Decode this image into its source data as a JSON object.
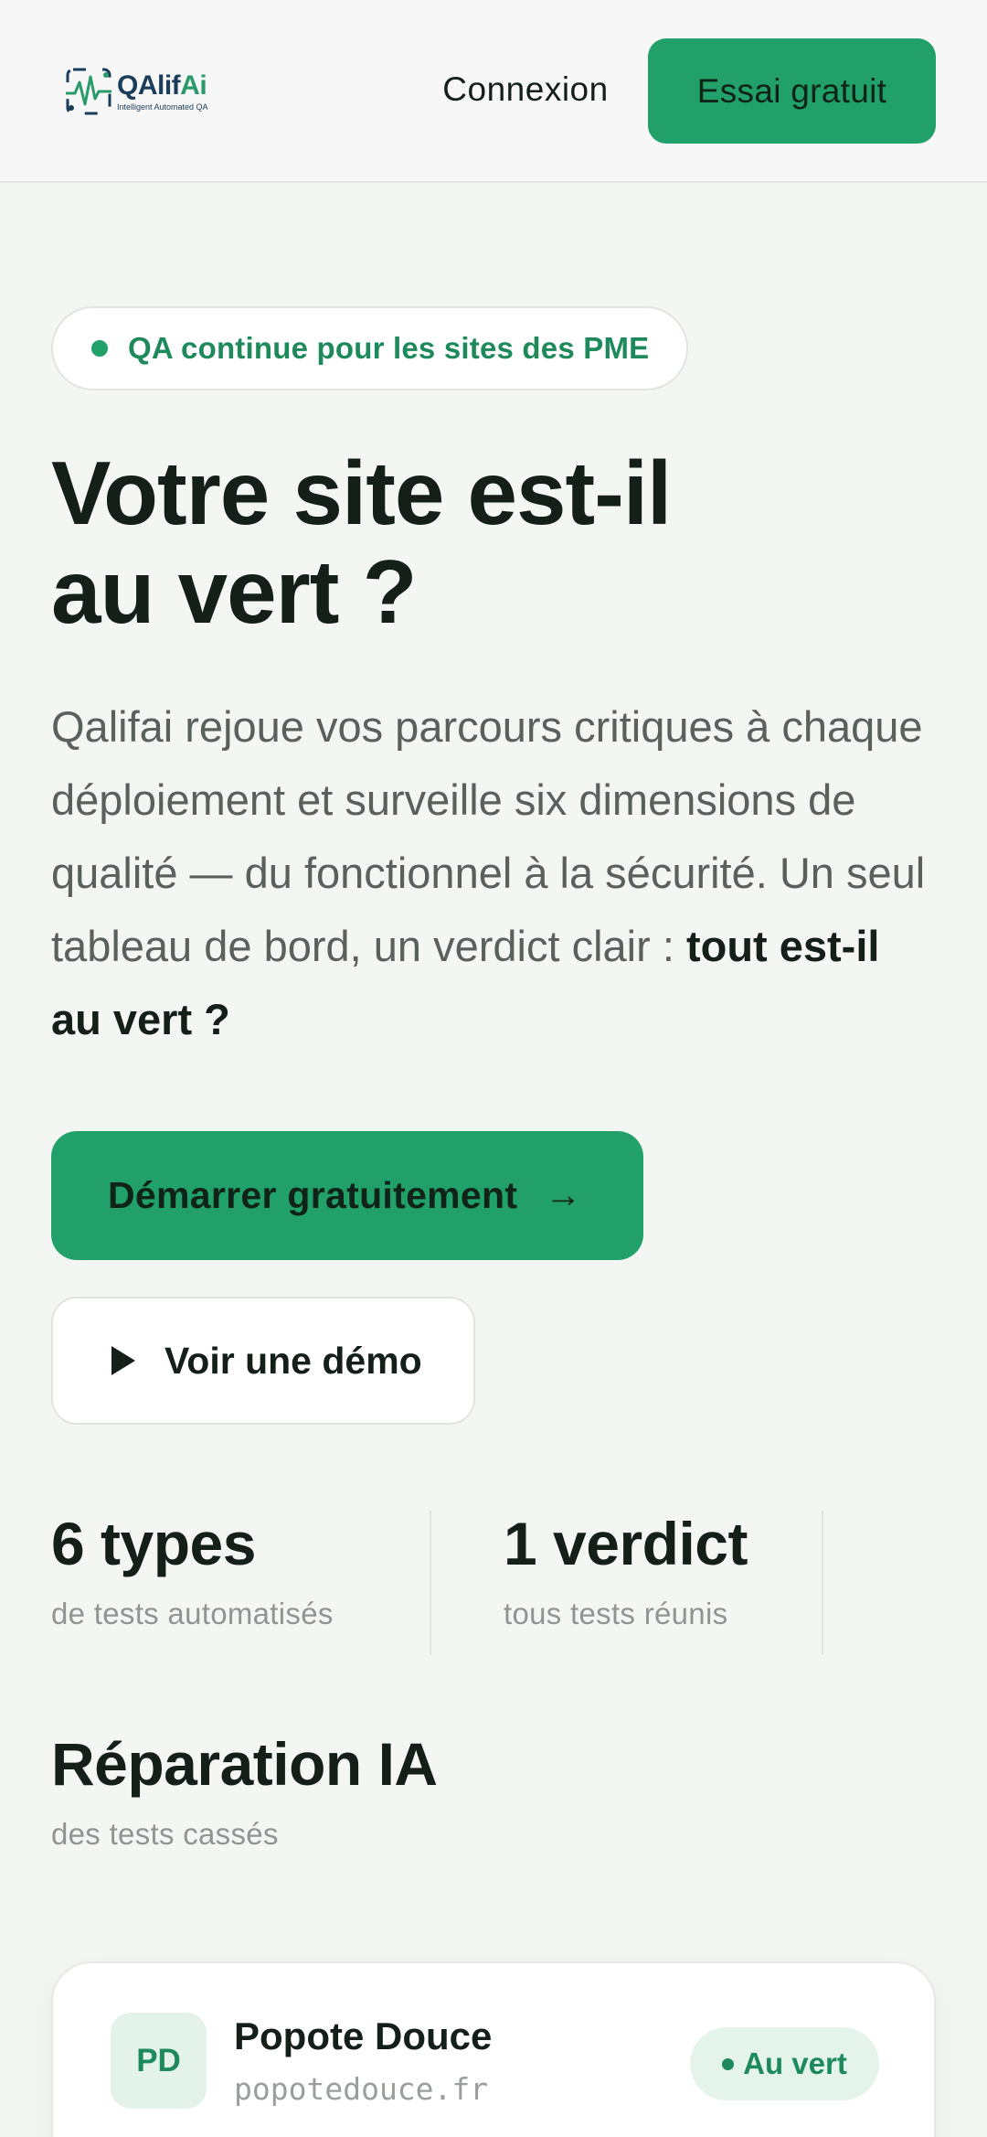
{
  "header": {
    "logo": {
      "name_main": "QAlif",
      "name_accent": "Ai",
      "tagline": "Intelligent Automated QA"
    },
    "login_label": "Connexion",
    "trial_label": "Essai gratuit"
  },
  "hero": {
    "badge": "QA continue pour les sites des PME",
    "title_line1": "Votre site est-il",
    "title_line2": "au vert ?",
    "description": "Qalifai rejoue vos parcours critiques à chaque déploiement et surveille six dimensions de qualité — du fonctionnel à la sécurité. Un seul tableau de bord, un verdict clair : ",
    "description_strong": "tout est-il au vert ?",
    "cta_primary": "Démarrer gratuitement",
    "cta_primary_arrow": "→",
    "cta_secondary": "Voir une démo"
  },
  "stats": [
    {
      "value": "6 types",
      "label": "de tests automatisés"
    },
    {
      "value": "1 verdict",
      "label": "tous tests réunis"
    },
    {
      "value": "Réparation IA",
      "label": "des tests cassés"
    }
  ],
  "card": {
    "initials": "PD",
    "name": "Popote Douce",
    "domain": "popotedouce.fr",
    "status": "Au vert"
  },
  "colors": {
    "brand_green": "#21a06a",
    "text_dark": "#141f1a",
    "muted": "#5a615d"
  }
}
